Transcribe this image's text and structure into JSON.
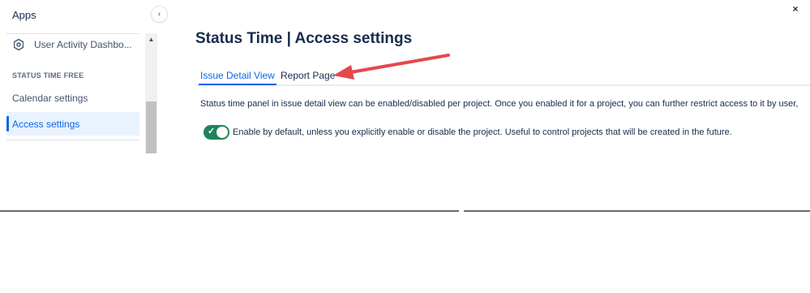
{
  "sidebar": {
    "apps_title": "Apps",
    "app_item_label": "User Activity Dashbo...",
    "section_title": "STATUS TIME FREE",
    "items": [
      {
        "label": "Calendar settings"
      },
      {
        "label": "Access settings"
      }
    ]
  },
  "header": {
    "title": "Status Time | Access settings",
    "close_label": "×"
  },
  "tabs": [
    {
      "label": "Issue Detail View"
    },
    {
      "label": "Report Page"
    }
  ],
  "description": "Status time panel in issue detail view can be enabled/disabled per project. Once you enabled it for a project, you can further restrict access to it by user,",
  "toggle": {
    "checked": true,
    "label": "Enable by default, unless you explicitly enable or disable the project. Useful to control projects that will be created in the future."
  },
  "colors": {
    "accent": "#0c66e4",
    "toggle_on": "#1f845a",
    "annotation_arrow": "#e5484d"
  },
  "icons": {
    "collapse": "chevron-left-icon",
    "app": "hexagon-gear-icon",
    "close": "close-icon",
    "scroll_up": "scroll-up-arrow-icon",
    "toggle_check": "check-icon"
  }
}
